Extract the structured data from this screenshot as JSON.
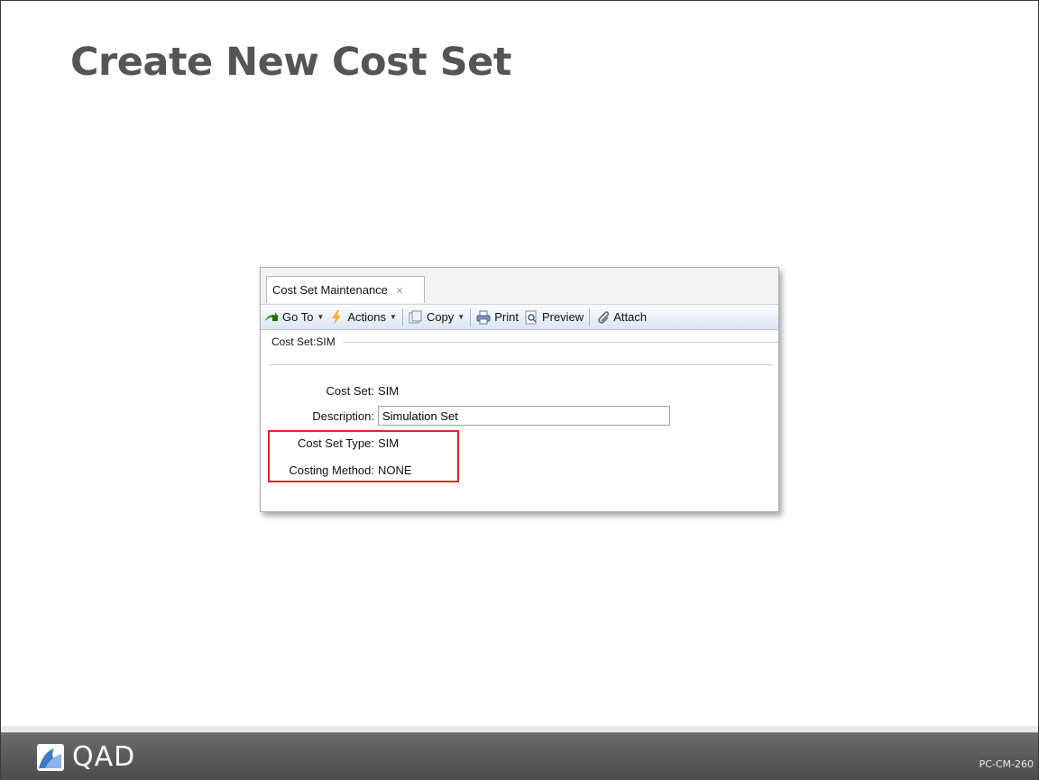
{
  "slide": {
    "title": "Create New Cost Set",
    "code": "PC-CM-260"
  },
  "logo": {
    "text": "QAD",
    "icon": "qad-logo-icon"
  },
  "window": {
    "tab": {
      "label": "Cost Set Maintenance",
      "close_glyph": "×"
    },
    "toolbar": {
      "goto": "Go To",
      "actions": "Actions",
      "copy": "Copy",
      "print": "Print",
      "preview": "Preview",
      "attach": "Attach"
    },
    "section": "Cost Set:SIM",
    "fields": {
      "cost_set": {
        "label": "Cost Set:",
        "value": "SIM"
      },
      "description": {
        "label": "Description:",
        "value": "Simulation Set"
      },
      "cost_set_type": {
        "label": "Cost Set Type:",
        "value": "SIM"
      },
      "costing_method": {
        "label": "Costing Method:",
        "value": "NONE"
      }
    }
  },
  "colors": {
    "highlight": "#e0242c",
    "title": "#555555",
    "footer": "#5a5a5a"
  }
}
